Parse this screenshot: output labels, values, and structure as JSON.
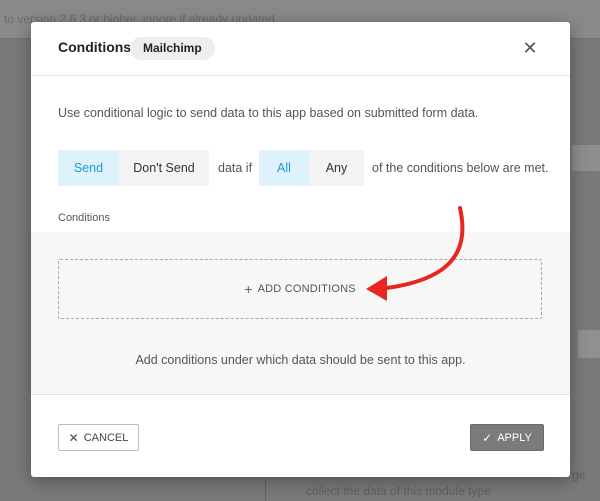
{
  "background": {
    "top_text": "to version 2.6.3 or higher, ignore if already updated.",
    "bottom_text": "collect the data of this module type",
    "bottom_text_right": "ge"
  },
  "modal": {
    "title": "Conditions",
    "app_badge": "Mailchimp",
    "close_icon": "close-icon",
    "description": "Use conditional logic to send data to this app based on submitted form data.",
    "action_options": [
      {
        "label": "Send",
        "selected": true
      },
      {
        "label": "Don't Send",
        "selected": false
      }
    ],
    "data_if_text": "data if",
    "match_options": [
      {
        "label": "All",
        "selected": true
      },
      {
        "label": "Any",
        "selected": false
      }
    ],
    "conditions_met_text": "of the conditions below are met.",
    "conditions_label": "Conditions",
    "add_conditions_label": "ADD CONDITIONS",
    "helper_text": "Add conditions under which data should be sent to this app.",
    "cancel_label": "CANCEL",
    "apply_label": "APPLY"
  },
  "colors": {
    "accent": "#1c9bd6",
    "accent_bg": "#dff2fb",
    "arrow": "#e8261f",
    "apply_bg": "#7b7b7b"
  }
}
